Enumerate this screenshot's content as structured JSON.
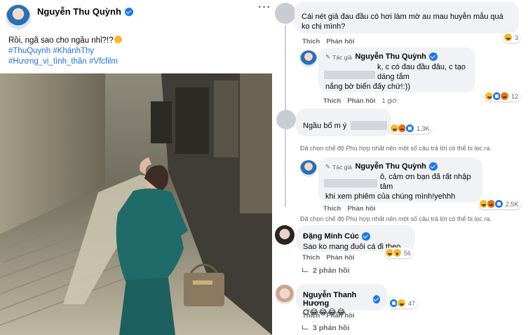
{
  "post": {
    "author": "Nguyễn Thu Quỳnh",
    "more": "···",
    "text_line1": "Rồi, ngã sao cho ngầu nhỉ?!?",
    "hashtag1": "#ThuQuynh",
    "hashtag2": "#KhánhThy",
    "hashtag3": "#Hương_vị_tình_thân",
    "hashtag4": "#Vfcfilm"
  },
  "comments": {
    "c1": {
      "text": "Cái nét giả đau đầu có hơi làm mờ au mau huyễn mẫu quá ko chị mình?",
      "like": "Thích",
      "reply": "Phản hồi",
      "reaction_count": "3"
    },
    "r1": {
      "tag": "Tác giả",
      "name": "Nguyễn Thu Quỳnh",
      "text_line1": "k, c có đau đầu đâu, c tạo dáng tắm",
      "text_line2": "nắng bờ biển đấy chứ!:))",
      "like": "Thích",
      "reply": "Phản hồi",
      "time": "1 giờ",
      "reaction_count": "12"
    },
    "c2": {
      "text": "Ngầu bổ m ý",
      "reaction_count": "1,3K",
      "filter_note": "Đã chọn chế độ Phù hợp nhất nên một số câu trả lời có thể bị lọc ra."
    },
    "r2": {
      "tag": "Tác giả",
      "name": "Nguyễn Thu Quỳnh",
      "text_line1": "ô, cảm ơn bạn đã rất nhập tâm",
      "text_line2": "khi xem phiêm của chúng mình!yehhh",
      "like": "Thích",
      "reply": "Phản hồi",
      "reaction_count": "2,5K",
      "filter_note": "Đã chọn chế độ Phù hợp nhất nên một số câu trả lời có thể bị lọc ra."
    },
    "c3": {
      "name": "Đặng Minh Cúc",
      "text": "Sao ko mang đuôi cá đi theo",
      "like": "Thích",
      "reply": "Phản hồi",
      "reaction_count": "56",
      "replies": "2 phản hồi"
    },
    "c4": {
      "name": "Nguyễn Thanh Hương",
      "text": "Ơ😂😂😂😂",
      "like": "Thích",
      "reply": "Phản hồi",
      "reaction_count": "47",
      "replies": "3 phản hồi"
    }
  }
}
